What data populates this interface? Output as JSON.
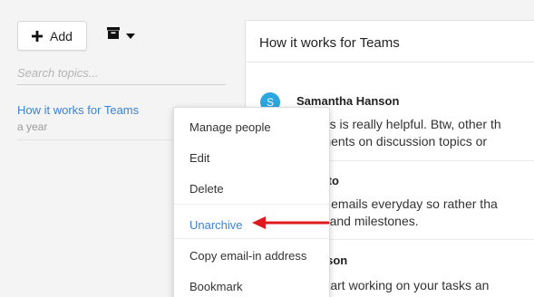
{
  "toolbar": {
    "add_label": "Add",
    "add_icon": "plus-icon",
    "archive_icon": "archive-box-icon",
    "dropdown_icon": "caret-down-icon"
  },
  "search": {
    "placeholder": "Search topics...",
    "value": ""
  },
  "topics": [
    {
      "title": "How it works for Teams",
      "time": "a year"
    }
  ],
  "panel": {
    "title": "How it works for Teams",
    "avatar_letter": "S",
    "avatar_color": "#2aa6e0",
    "comments": [
      {
        "author": "Samantha Hanson",
        "lines": [
          "ks, this is really helpful. Btw, other th",
          "comments on discussion topics or"
        ]
      },
      {
        "author": "el Pinto",
        "lines": [
          "ots of emails everyday so rather tha",
          "tasks and milestones."
        ]
      },
      {
        "author": "w Wilson",
        "lines": [
          "you start working on your tasks an"
        ]
      }
    ]
  },
  "context_menu": {
    "items": [
      "Manage people",
      "Edit",
      "Delete",
      "Unarchive",
      "Copy email-in address",
      "Bookmark"
    ],
    "active_item": "Unarchive"
  },
  "colors": {
    "link_blue": "#3a83d6",
    "arrow_red": "#e0191e"
  }
}
